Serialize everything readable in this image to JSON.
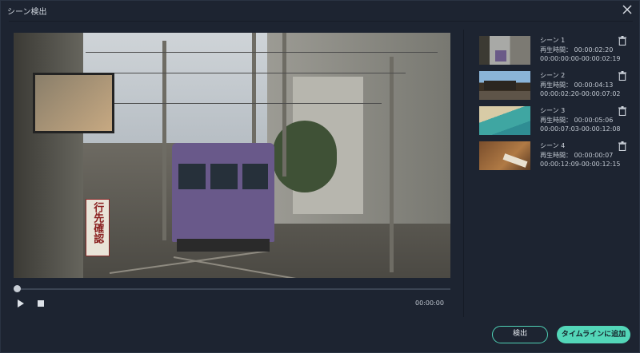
{
  "window": {
    "title": "シーン検出",
    "close_icon": "close-icon"
  },
  "player": {
    "current_time": "00:00:00",
    "progress": 0,
    "controls": {
      "play_icon": "play-icon",
      "stop_icon": "stop-icon"
    },
    "sign_text": "行先確認"
  },
  "scenes": [
    {
      "name": "シーン 1",
      "duration": "再生時間： 00:00:02:20",
      "range": "00:00:00:00-00:00:02:19"
    },
    {
      "name": "シーン 2",
      "duration": "再生時間： 00:00:04:13",
      "range": "00:00:02:20-00:00:07:02"
    },
    {
      "name": "シーン 3",
      "duration": "再生時間： 00:00:05:06",
      "range": "00:00:07:03-00:00:12:08"
    },
    {
      "name": "シーン 4",
      "duration": "再生時間： 00:00:00:07",
      "range": "00:00:12:09-00:00:12:15"
    }
  ],
  "buttons": {
    "detect": "検出",
    "add_to_timeline": "タイムラインに追加"
  },
  "colors": {
    "background": "#1d2431",
    "accent": "#53d6b8"
  }
}
